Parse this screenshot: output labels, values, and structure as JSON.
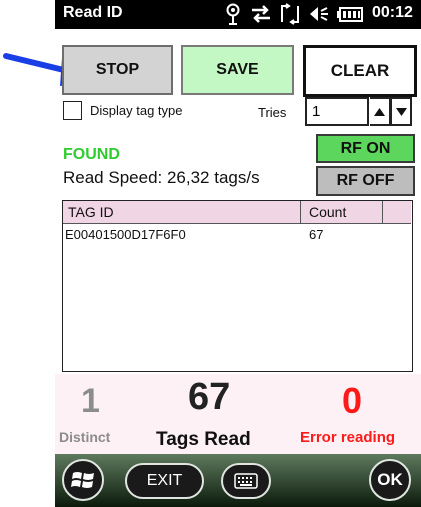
{
  "status_bar": {
    "title": "Read ID",
    "time": "00:12"
  },
  "buttons": {
    "stop": "STOP",
    "save": "SAVE",
    "clear": "CLEAR",
    "rf_on": "RF ON",
    "rf_off": "RF OFF"
  },
  "options": {
    "display_tag_type": "Display tag type",
    "tries_label": "Tries",
    "tries_value": "1"
  },
  "status": {
    "found": "FOUND",
    "read_speed": "Read Speed: 26,32 tags/s"
  },
  "table": {
    "columns": [
      "TAG ID",
      "Count"
    ],
    "rows": [
      {
        "tag_id": "E00401500D17F6F0",
        "count": "67"
      }
    ]
  },
  "counters": {
    "distinct_value": "1",
    "distinct_label": "Distinct",
    "tags_read_value": "67",
    "tags_read_label": "Tags Read",
    "error_value": "0",
    "error_label": "Error reading"
  },
  "bottom_bar": {
    "exit": "EXIT",
    "ok": "OK"
  },
  "colors": {
    "found": "#2ecc2e",
    "error": "#ff1a1a",
    "rf_on": "#5cd65c",
    "save": "#c3f7c3",
    "header": "#f0d6e4",
    "arrow": "#1a3ee6"
  }
}
